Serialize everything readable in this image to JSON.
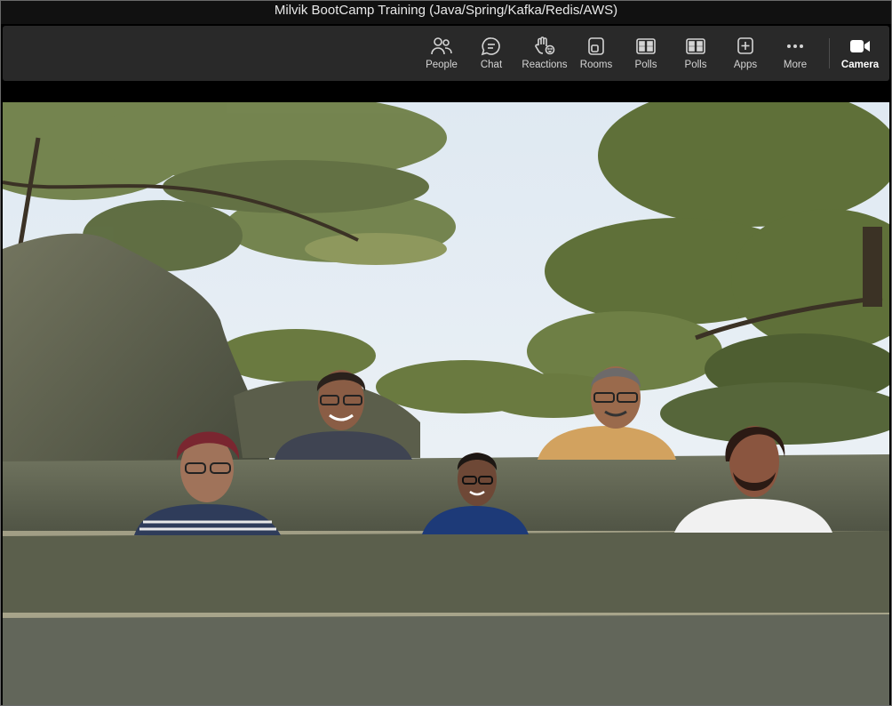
{
  "window": {
    "title": "Milvik BootCamp Training (Java/Spring/Kafka/Redis/AWS)"
  },
  "toolbar": {
    "items": [
      {
        "label": "People",
        "icon": "people-icon"
      },
      {
        "label": "Chat",
        "icon": "chat-icon"
      },
      {
        "label": "Reactions",
        "icon": "raise-hand-icon"
      },
      {
        "label": "Rooms",
        "icon": "rooms-icon"
      },
      {
        "label": "Polls",
        "icon": "polls-icon"
      },
      {
        "label": "Polls",
        "icon": "polls-icon"
      },
      {
        "label": "Apps",
        "icon": "apps-icon"
      },
      {
        "label": "More",
        "icon": "more-icon"
      },
      {
        "label": "Camera",
        "icon": "camera-icon"
      }
    ]
  },
  "meeting": {
    "view": "together-mode",
    "participant_count": 5
  },
  "colors": {
    "title_bar": "#111111",
    "toolbar": "#292929",
    "toolbar_text": "#d4d4d4",
    "sky": "#e6eff6",
    "foliage": "#6f7f47",
    "rock": "#5f6150"
  }
}
